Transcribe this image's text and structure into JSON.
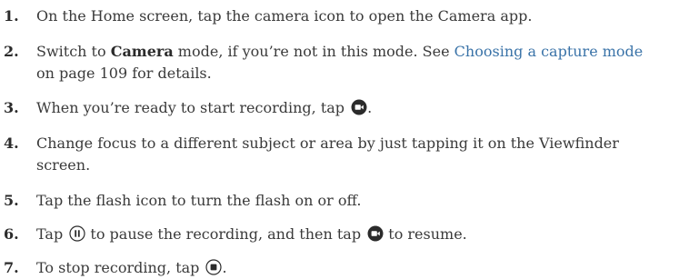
{
  "steps": [
    {
      "number": "1.",
      "text": "On the Home screen, tap the camera icon to open the Camera app."
    },
    {
      "number": "2.",
      "pre": "Switch to ",
      "bold": "Camera",
      "mid": " mode, if you’re not in this mode. See ",
      "link": "Choosing a capture mode",
      "post": " on page 109 for details."
    },
    {
      "number": "3.",
      "pre": "When you’re ready to start recording, tap ",
      "icon": "record-video-icon",
      "post": "."
    },
    {
      "number": "4.",
      "text": "Change focus to a different subject or area by just tapping it on the Viewfinder screen."
    },
    {
      "number": "5.",
      "text": "Tap the flash icon to turn the flash on or off."
    },
    {
      "number": "6.",
      "pre": "Tap ",
      "icon1": "pause-icon",
      "mid": " to pause the recording, and then tap ",
      "icon2": "record-video-icon",
      "post": " to resume."
    },
    {
      "number": "7.",
      "pre": "To stop recording, tap ",
      "icon": "stop-icon",
      "post": "."
    }
  ],
  "colors": {
    "text": "#3a3a3a",
    "number": "#2b2b2b",
    "link": "#3a73a8",
    "icon": "#2b2b2b"
  }
}
